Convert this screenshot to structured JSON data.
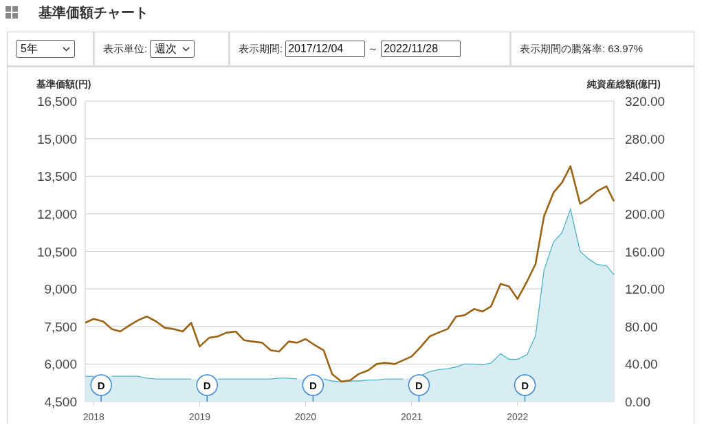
{
  "page_title": "基準価額チャート",
  "toolbar": {
    "range_select": {
      "value": "5年"
    },
    "unit_label": "表示単位:",
    "unit_select": {
      "value": "週次"
    },
    "period_label": "表示期間:",
    "start_date": {
      "value": "2017/12/04"
    },
    "separator": "～",
    "end_date": {
      "value": "2022/11/28"
    },
    "change_label": "表示期間の騰落率: 63.97%"
  },
  "chart": {
    "chart_data": {
      "type": "line",
      "ylabel": "基準価額(円)",
      "y2label": "純資産総額(億円)",
      "x": [
        2017.92,
        2018.0,
        2018.09,
        2018.17,
        2018.25,
        2018.34,
        2018.42,
        2018.5,
        2018.59,
        2018.67,
        2018.75,
        2018.84,
        2018.92,
        2019.0,
        2019.09,
        2019.17,
        2019.25,
        2019.34,
        2019.42,
        2019.5,
        2019.59,
        2019.67,
        2019.75,
        2019.84,
        2019.92,
        2020.0,
        2020.09,
        2020.17,
        2020.25,
        2020.34,
        2020.42,
        2020.5,
        2020.59,
        2020.67,
        2020.75,
        2020.84,
        2020.92,
        2021.0,
        2021.09,
        2021.17,
        2021.25,
        2021.34,
        2021.42,
        2021.5,
        2021.59,
        2021.67,
        2021.75,
        2021.84,
        2021.92,
        2022.0,
        2022.09,
        2022.17,
        2022.25,
        2022.34,
        2022.42,
        2022.5,
        2022.59,
        2022.67,
        2022.75,
        2022.84,
        2022.91
      ],
      "series": [
        {
          "type": "line",
          "color": "#9a6414",
          "values": [
            7650,
            7800,
            7700,
            7400,
            7300,
            7550,
            7750,
            7900,
            7700,
            7450,
            7400,
            7300,
            7650,
            6700,
            7050,
            7100,
            7250,
            7300,
            6950,
            6900,
            6850,
            6550,
            6500,
            6900,
            6850,
            7000,
            6750,
            6550,
            5600,
            5300,
            5350,
            5600,
            5750,
            6000,
            6050,
            6000,
            6150,
            6300,
            6700,
            7100,
            7250,
            7400,
            7900,
            7950,
            8200,
            8100,
            8300,
            9200,
            9100,
            8600,
            9300,
            10000,
            11900,
            12850,
            13250,
            13900,
            12400,
            12600,
            12900,
            13100,
            12500
          ]
        },
        {
          "type": "area",
          "axis": "y2",
          "color": "#4fb3c8",
          "values": [
            27,
            27,
            null,
            27,
            27,
            27,
            27,
            25,
            24,
            24,
            24,
            24,
            24,
            null,
            null,
            24,
            24,
            24,
            24,
            24,
            24,
            24,
            25,
            25,
            24,
            null,
            null,
            24,
            22,
            21,
            22,
            22,
            23,
            23,
            24,
            24,
            24,
            null,
            28,
            32,
            34,
            35,
            37,
            40,
            40,
            39,
            41,
            51,
            45,
            45,
            50,
            70,
            140,
            170,
            180,
            205,
            160,
            152,
            146,
            145,
            135
          ]
        }
      ],
      "grid": true,
      "xlim": [
        2017.92,
        2022.91
      ],
      "ylim": [
        4500,
        16500
      ],
      "y2lim": [
        0,
        320
      ],
      "xticks": [
        2018,
        2019,
        2020,
        2021,
        2022
      ],
      "yticks": [
        {
          "value": 4500,
          "label": "4,500"
        },
        {
          "value": 6000,
          "label": "6,000"
        },
        {
          "value": 7500,
          "label": "7,500"
        },
        {
          "value": 9000,
          "label": "9,000"
        },
        {
          "value": 10500,
          "label": "10,500"
        },
        {
          "value": 12000,
          "label": "12,000"
        },
        {
          "value": 13500,
          "label": "13,500"
        },
        {
          "value": 15000,
          "label": "15,000"
        },
        {
          "value": 16500,
          "label": "16,500"
        }
      ],
      "y2ticks": [
        {
          "value": 0,
          "label": "0.00"
        },
        {
          "value": 40,
          "label": "40.00"
        },
        {
          "value": 80,
          "label": "80.00"
        },
        {
          "value": 120,
          "label": "120.00"
        },
        {
          "value": 160,
          "label": "160.00"
        },
        {
          "value": 200,
          "label": "200.00"
        },
        {
          "value": 240,
          "label": "240.00"
        },
        {
          "value": 280,
          "label": "280.00"
        },
        {
          "value": 320,
          "label": "320.00"
        }
      ],
      "annotations": [
        {
          "x": 2018.07,
          "text": "D"
        },
        {
          "x": 2019.07,
          "text": "D"
        },
        {
          "x": 2020.07,
          "text": "D"
        },
        {
          "x": 2021.07,
          "text": "D"
        },
        {
          "x": 2022.07,
          "text": "D"
        }
      ]
    }
  }
}
